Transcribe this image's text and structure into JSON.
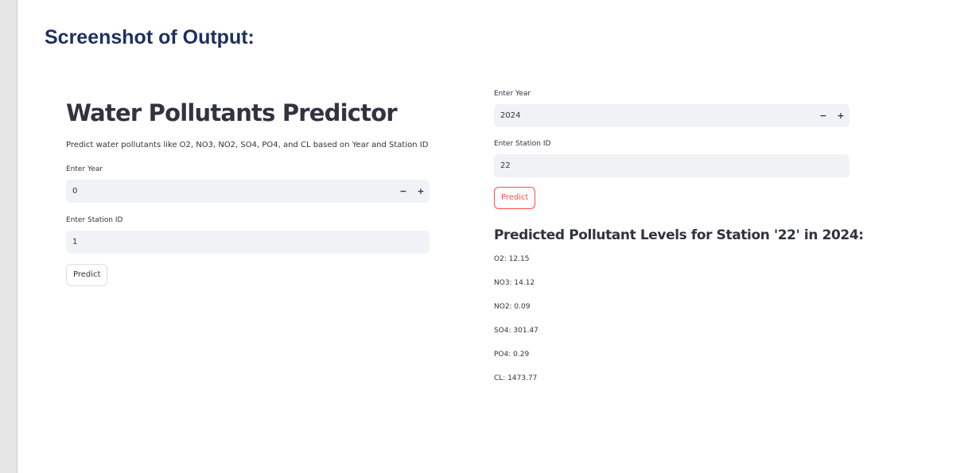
{
  "heading": "Screenshot of Output:",
  "left": {
    "title": "Water Pollutants Predictor",
    "description": "Predict water pollutants like O2, NO3, NO2, SO4, PO4, and CL based on Year and Station ID",
    "year_label": "Enter Year",
    "year_value": "0",
    "station_label": "Enter Station ID",
    "station_value": "1",
    "predict_label": "Predict"
  },
  "right": {
    "year_label": "Enter Year",
    "year_value": "2024",
    "station_label": "Enter Station ID",
    "station_value": "22",
    "predict_label": "Predict",
    "result_title": "Predicted Pollutant Levels for Station '22' in 2024:",
    "results": [
      "O2: 12.15",
      "NO3: 14.12",
      "NO2: 0.09",
      "SO4: 301.47",
      "PO4: 0.29",
      "CL: 1473.77"
    ]
  },
  "stepper": {
    "minus": "−",
    "plus": "+"
  },
  "colors": {
    "heading": "#1f2f5f",
    "accent": "#ff4b4b",
    "input_bg": "#f0f2f6",
    "text": "#31333f"
  }
}
